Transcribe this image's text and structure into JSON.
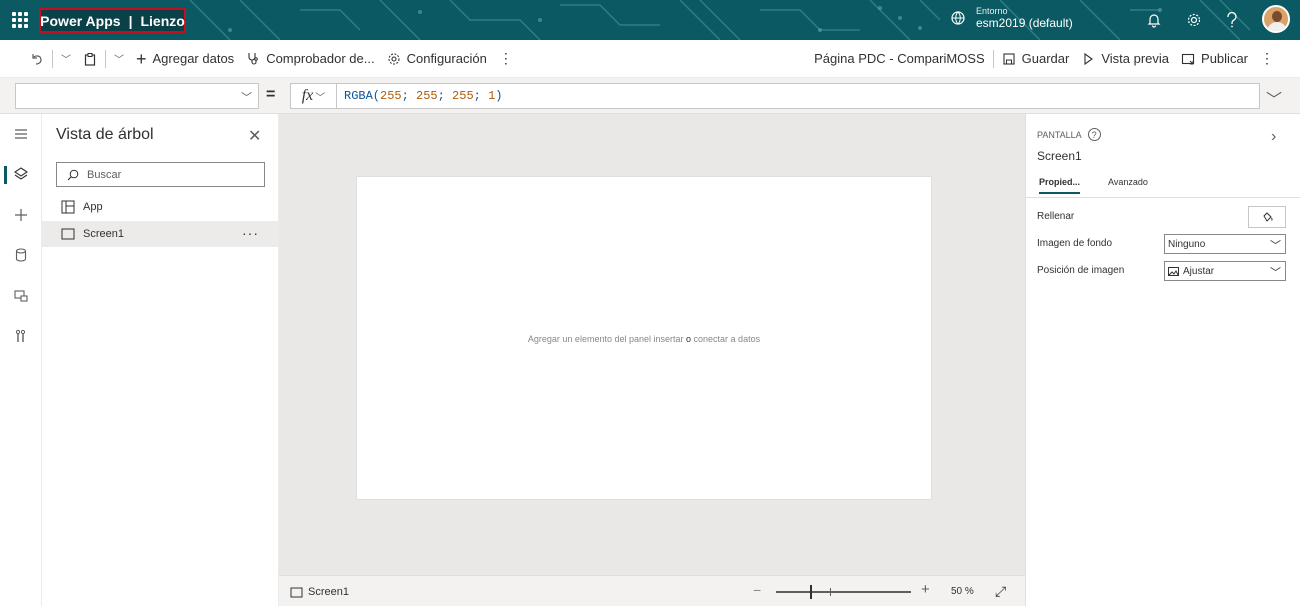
{
  "header": {
    "product": "Power Apps",
    "separator": "|",
    "app_type": "Lienzo",
    "env_label": "Entorno",
    "env_name": "esm2019 (default)"
  },
  "commands": {
    "add_data": "Agregar datos",
    "checker": "Comprobador de...",
    "settings": "Configuración",
    "app_name": "Página PDC - CompariMOSS",
    "save": "Guardar",
    "preview": "Vista previa",
    "publish": "Publicar"
  },
  "formula": {
    "property": "",
    "fx": "fx",
    "fn": "RGBA(",
    "args": [
      "255",
      "255",
      "255",
      "1"
    ],
    "sep": "; ",
    "close": ")"
  },
  "tree": {
    "title": "Vista de árbol",
    "search_placeholder": "Buscar",
    "items": [
      {
        "label": "App",
        "selected": false
      },
      {
        "label": "Screen1",
        "selected": true
      }
    ]
  },
  "canvas": {
    "hint_a": "Agregar un elemento del panel insertar ",
    "hint_or": "o",
    "hint_b": " conectar a datos"
  },
  "status": {
    "screen": "Screen1",
    "zoom": "50 %",
    "zoom_minus": "−",
    "zoom_plus": "+"
  },
  "props": {
    "kind": "PANTALLA",
    "name": "Screen1",
    "tabs": [
      "Propied...",
      "Avanzado"
    ],
    "fill_label": "Rellenar",
    "bg_image_label": "Imagen de fondo",
    "bg_image_value": "Ninguno",
    "image_pos_label": "Posición de imagen",
    "image_pos_value": "Ajustar"
  },
  "colors": {
    "banner": "#0b5a63",
    "highlight": "#c50f1f",
    "canvas_bg": "#e9e8e7"
  }
}
